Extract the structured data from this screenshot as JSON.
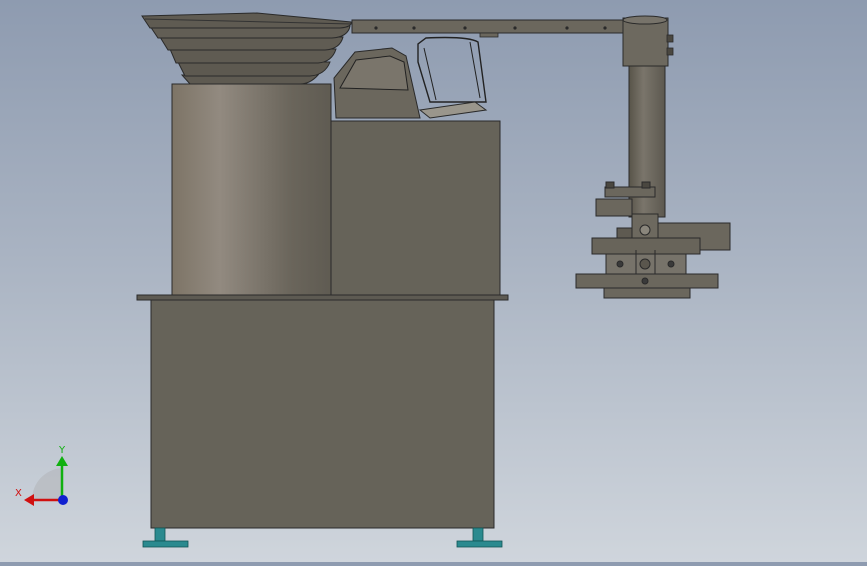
{
  "window": {
    "title": ""
  },
  "triad": {
    "x_label": "X",
    "y_label": "Y",
    "x_color": "#d01010",
    "y_color": "#10b010",
    "z_color": "#1020d0"
  },
  "colors": {
    "background_top": "#8e9bb0",
    "background_bottom": "#cfd5dc",
    "body_gray": "#666359",
    "edge_dark": "#2a2a2a",
    "foot_teal": "#2a8a8f"
  },
  "model": {
    "parts": [
      "feeder-bowl",
      "bowl-base-cylinder",
      "control-box",
      "cabinet",
      "table-top",
      "crossbar-arm",
      "vertical-post",
      "gripper-head",
      "foot-left",
      "foot-right"
    ]
  }
}
